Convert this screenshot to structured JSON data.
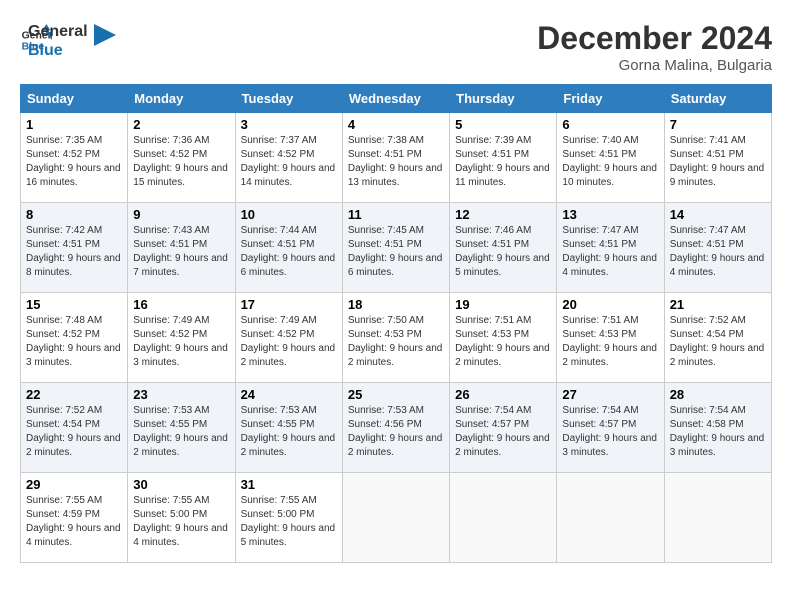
{
  "logo": {
    "line1": "General",
    "line2": "Blue"
  },
  "title": "December 2024",
  "subtitle": "Gorna Malina, Bulgaria",
  "headers": [
    "Sunday",
    "Monday",
    "Tuesday",
    "Wednesday",
    "Thursday",
    "Friday",
    "Saturday"
  ],
  "weeks": [
    [
      {
        "day": "1",
        "info": "Sunrise: 7:35 AM\nSunset: 4:52 PM\nDaylight: 9 hours and 16 minutes."
      },
      {
        "day": "2",
        "info": "Sunrise: 7:36 AM\nSunset: 4:52 PM\nDaylight: 9 hours and 15 minutes."
      },
      {
        "day": "3",
        "info": "Sunrise: 7:37 AM\nSunset: 4:52 PM\nDaylight: 9 hours and 14 minutes."
      },
      {
        "day": "4",
        "info": "Sunrise: 7:38 AM\nSunset: 4:51 PM\nDaylight: 9 hours and 13 minutes."
      },
      {
        "day": "5",
        "info": "Sunrise: 7:39 AM\nSunset: 4:51 PM\nDaylight: 9 hours and 11 minutes."
      },
      {
        "day": "6",
        "info": "Sunrise: 7:40 AM\nSunset: 4:51 PM\nDaylight: 9 hours and 10 minutes."
      },
      {
        "day": "7",
        "info": "Sunrise: 7:41 AM\nSunset: 4:51 PM\nDaylight: 9 hours and 9 minutes."
      }
    ],
    [
      {
        "day": "8",
        "info": "Sunrise: 7:42 AM\nSunset: 4:51 PM\nDaylight: 9 hours and 8 minutes."
      },
      {
        "day": "9",
        "info": "Sunrise: 7:43 AM\nSunset: 4:51 PM\nDaylight: 9 hours and 7 minutes."
      },
      {
        "day": "10",
        "info": "Sunrise: 7:44 AM\nSunset: 4:51 PM\nDaylight: 9 hours and 6 minutes."
      },
      {
        "day": "11",
        "info": "Sunrise: 7:45 AM\nSunset: 4:51 PM\nDaylight: 9 hours and 6 minutes."
      },
      {
        "day": "12",
        "info": "Sunrise: 7:46 AM\nSunset: 4:51 PM\nDaylight: 9 hours and 5 minutes."
      },
      {
        "day": "13",
        "info": "Sunrise: 7:47 AM\nSunset: 4:51 PM\nDaylight: 9 hours and 4 minutes."
      },
      {
        "day": "14",
        "info": "Sunrise: 7:47 AM\nSunset: 4:51 PM\nDaylight: 9 hours and 4 minutes."
      }
    ],
    [
      {
        "day": "15",
        "info": "Sunrise: 7:48 AM\nSunset: 4:52 PM\nDaylight: 9 hours and 3 minutes."
      },
      {
        "day": "16",
        "info": "Sunrise: 7:49 AM\nSunset: 4:52 PM\nDaylight: 9 hours and 3 minutes."
      },
      {
        "day": "17",
        "info": "Sunrise: 7:49 AM\nSunset: 4:52 PM\nDaylight: 9 hours and 2 minutes."
      },
      {
        "day": "18",
        "info": "Sunrise: 7:50 AM\nSunset: 4:53 PM\nDaylight: 9 hours and 2 minutes."
      },
      {
        "day": "19",
        "info": "Sunrise: 7:51 AM\nSunset: 4:53 PM\nDaylight: 9 hours and 2 minutes."
      },
      {
        "day": "20",
        "info": "Sunrise: 7:51 AM\nSunset: 4:53 PM\nDaylight: 9 hours and 2 minutes."
      },
      {
        "day": "21",
        "info": "Sunrise: 7:52 AM\nSunset: 4:54 PM\nDaylight: 9 hours and 2 minutes."
      }
    ],
    [
      {
        "day": "22",
        "info": "Sunrise: 7:52 AM\nSunset: 4:54 PM\nDaylight: 9 hours and 2 minutes."
      },
      {
        "day": "23",
        "info": "Sunrise: 7:53 AM\nSunset: 4:55 PM\nDaylight: 9 hours and 2 minutes."
      },
      {
        "day": "24",
        "info": "Sunrise: 7:53 AM\nSunset: 4:55 PM\nDaylight: 9 hours and 2 minutes."
      },
      {
        "day": "25",
        "info": "Sunrise: 7:53 AM\nSunset: 4:56 PM\nDaylight: 9 hours and 2 minutes."
      },
      {
        "day": "26",
        "info": "Sunrise: 7:54 AM\nSunset: 4:57 PM\nDaylight: 9 hours and 2 minutes."
      },
      {
        "day": "27",
        "info": "Sunrise: 7:54 AM\nSunset: 4:57 PM\nDaylight: 9 hours and 3 minutes."
      },
      {
        "day": "28",
        "info": "Sunrise: 7:54 AM\nSunset: 4:58 PM\nDaylight: 9 hours and 3 minutes."
      }
    ],
    [
      {
        "day": "29",
        "info": "Sunrise: 7:55 AM\nSunset: 4:59 PM\nDaylight: 9 hours and 4 minutes."
      },
      {
        "day": "30",
        "info": "Sunrise: 7:55 AM\nSunset: 5:00 PM\nDaylight: 9 hours and 4 minutes."
      },
      {
        "day": "31",
        "info": "Sunrise: 7:55 AM\nSunset: 5:00 PM\nDaylight: 9 hours and 5 minutes."
      },
      {
        "day": "",
        "info": ""
      },
      {
        "day": "",
        "info": ""
      },
      {
        "day": "",
        "info": ""
      },
      {
        "day": "",
        "info": ""
      }
    ]
  ]
}
